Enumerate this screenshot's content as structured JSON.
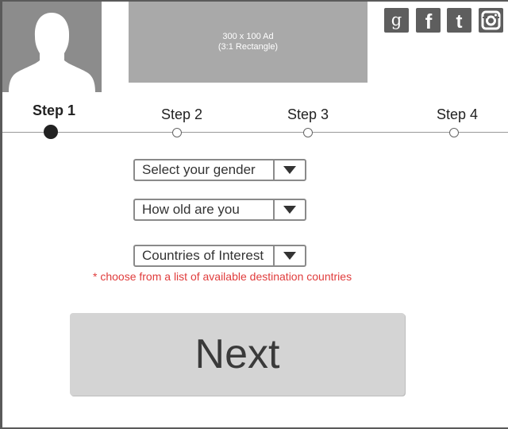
{
  "ad": {
    "line1": "300 x 100 Ad",
    "line2": "(3:1 Rectangle)"
  },
  "social": [
    {
      "name": "google",
      "icon": "google-icon"
    },
    {
      "name": "facebook",
      "icon": "facebook-icon"
    },
    {
      "name": "twitter",
      "icon": "twitter-icon"
    },
    {
      "name": "instagram",
      "icon": "instagram-icon"
    }
  ],
  "steps": [
    {
      "label": "Step 1",
      "active": true
    },
    {
      "label": "Step 2",
      "active": false
    },
    {
      "label": "Step 3",
      "active": false
    },
    {
      "label": "Step 4",
      "active": false
    }
  ],
  "form": {
    "gender": {
      "value": "Select your gender"
    },
    "age": {
      "value": "How old are you"
    },
    "countries": {
      "value": "Countries of Interest"
    },
    "countries_hint": "* choose from a list of available destination countries"
  },
  "next_label": "Next",
  "colors": {
    "accent_hint": "#e03c3c",
    "button_bg": "#d4d4d4",
    "placeholder_gray": "#a9a9a9"
  }
}
